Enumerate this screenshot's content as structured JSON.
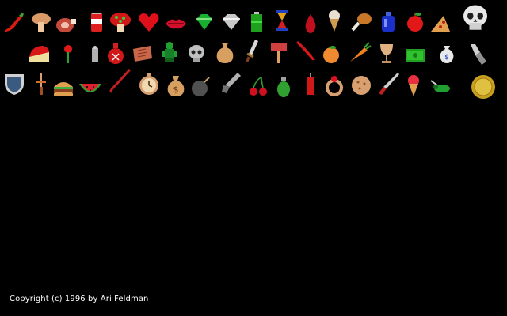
{
  "rows": [
    {
      "items": [
        "chili-pepper",
        "mushroom",
        "ham",
        "soda-can",
        "red-mushroom",
        "heart",
        "lips",
        "emerald",
        "diamond",
        "battery",
        "hourglass",
        "blood-drop",
        "ice-cream-cone",
        "drumstick",
        "potion-bottle",
        "apple",
        "pizza-slice",
        "skull"
      ]
    },
    {
      "items": [
        "cheese-wedge",
        "cherry-pin",
        "bullet",
        "poison-flask",
        "scroll",
        "green-idol",
        "grey-skull",
        "sack",
        "sword",
        "mallet",
        "red-feather",
        "orange",
        "carrot",
        "goblet",
        "cash",
        "money-bag-small",
        "flashlight"
      ]
    },
    {
      "items": [
        "shield",
        "dagger",
        "hamburger",
        "watermelon",
        "cane",
        "pocket-watch",
        "money-bag",
        "bomb",
        "pistol",
        "cherries",
        "grenade",
        "dynamite",
        "ring",
        "cookie",
        "knife",
        "ice-cream-scoop",
        "green-beetle",
        "gold-coin"
      ]
    }
  ],
  "colors": {
    "background": "#000000",
    "text": "#ffffff"
  },
  "copyright": "Copyright (c) 1996 by Ari Feldman"
}
